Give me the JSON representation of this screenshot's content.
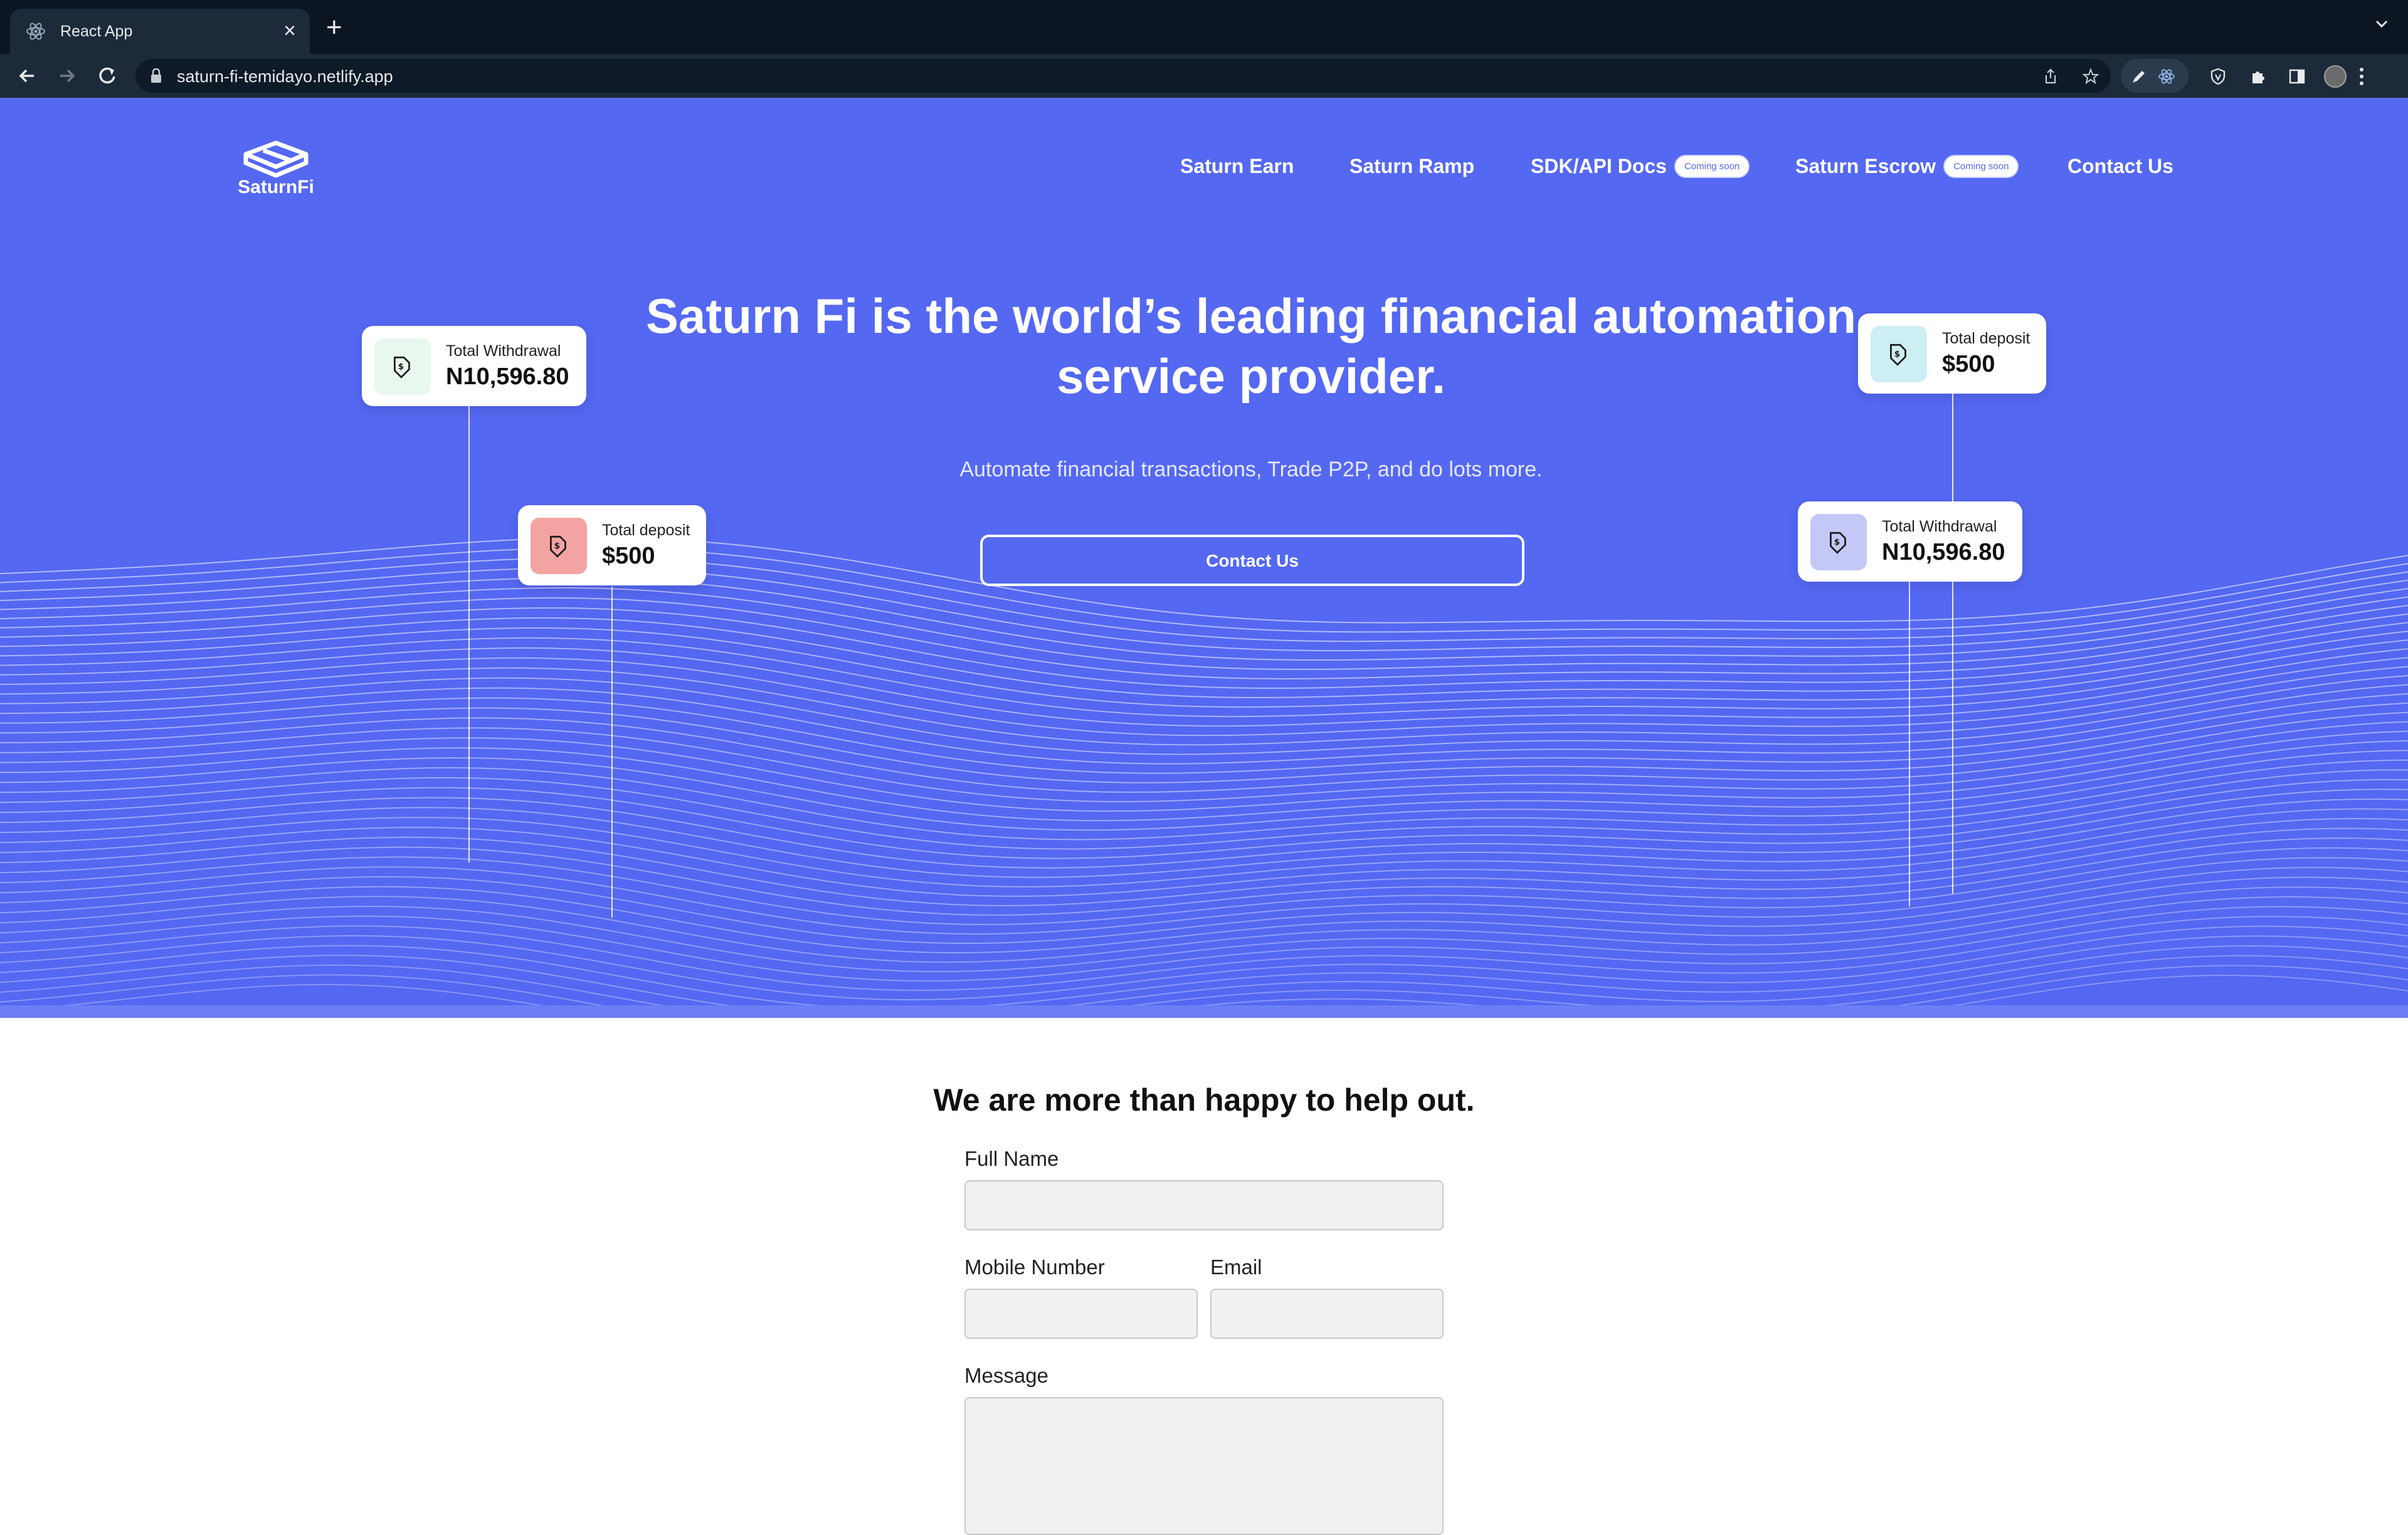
{
  "browser": {
    "tab_title": "React App",
    "tab_close": "×",
    "new_tab": "+",
    "url": "saturn-fi-temidayo.netlify.app",
    "icons": [
      "react-icon",
      "back-arrow-icon",
      "forward-arrow-icon",
      "reload-icon",
      "lock-icon",
      "share-icon",
      "star-icon",
      "pen-icon",
      "shield-icon",
      "puzzle-icon",
      "sidebar-icon",
      "kebab-icon"
    ]
  },
  "brand": {
    "name": "SaturnFi",
    "primary_color": "#5468f2"
  },
  "nav": {
    "items": [
      {
        "label": "Saturn Earn"
      },
      {
        "label": "Saturn Ramp"
      },
      {
        "label": "SDK/API Docs",
        "badge": "Coming soon"
      },
      {
        "label": "Saturn Escrow",
        "badge": "Coming soon"
      },
      {
        "label": "Contact Us"
      }
    ]
  },
  "hero": {
    "headline": "Saturn Fi is the world’s leading financial automation service provider.",
    "subtext": "Automate financial transactions, Trade P2P, and do lots more.",
    "cta_label": "Contact Us"
  },
  "stat_cards": [
    {
      "label": "Total Withdrawal",
      "value": "N10,596.80",
      "icon": "tag-icon",
      "icon_bg": "#e9f8ee"
    },
    {
      "label": "Total deposit",
      "value": "$500",
      "icon": "tag-icon",
      "icon_bg": "#f4a3a3"
    },
    {
      "label": "Total deposit",
      "value": "$500",
      "icon": "tag-icon",
      "icon_bg": "#cdeef3"
    },
    {
      "label": "Total Withdrawal",
      "value": "N10,596.80",
      "icon": "tag-icon",
      "icon_bg": "#c4c8f7"
    }
  ],
  "contact_form": {
    "title": "We are more than happy to help out.",
    "full_name_label": "Full Name",
    "full_name_value": "",
    "mobile_label": "Mobile Number",
    "mobile_value": "",
    "email_label": "Email",
    "email_value": "",
    "message_label": "Message",
    "message_value": ""
  }
}
